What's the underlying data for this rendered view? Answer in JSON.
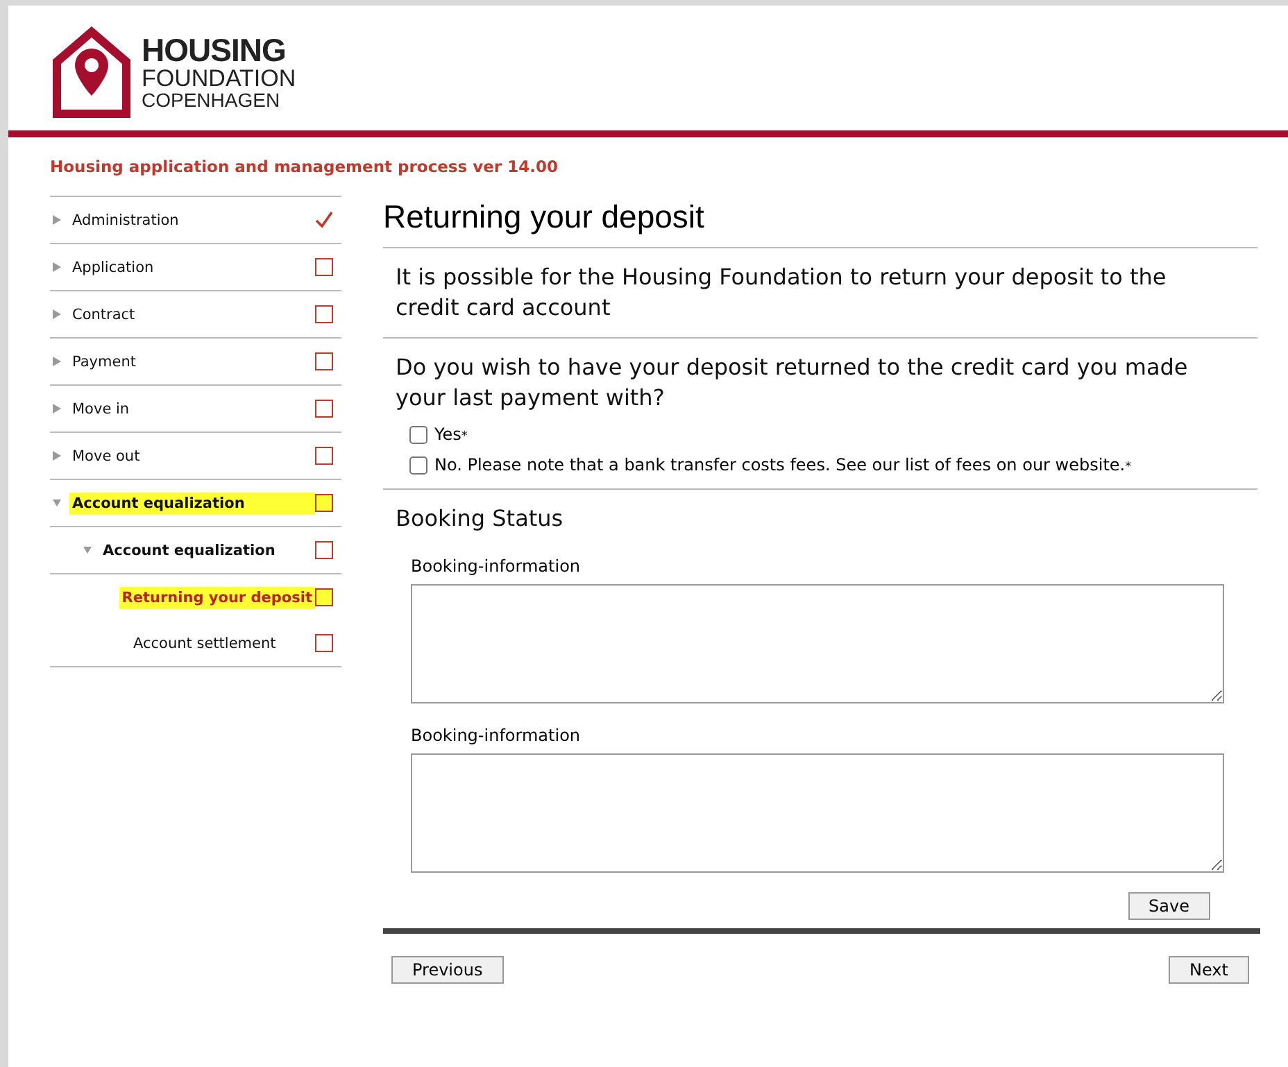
{
  "logo": {
    "line1": "HOUSING",
    "line2": "FOUNDATION",
    "line3": "COPENHAGEN"
  },
  "process_title": "Housing application and management process ver 14.00",
  "sidebar": {
    "items": [
      {
        "label": "Administration",
        "expanded": false,
        "done": true,
        "highlighted": false,
        "selected": false
      },
      {
        "label": "Application",
        "expanded": false,
        "done": false,
        "highlighted": false,
        "selected": false
      },
      {
        "label": "Contract",
        "expanded": false,
        "done": false,
        "highlighted": false,
        "selected": false
      },
      {
        "label": "Payment",
        "expanded": false,
        "done": false,
        "highlighted": false,
        "selected": false
      },
      {
        "label": "Move in",
        "expanded": false,
        "done": false,
        "highlighted": false,
        "selected": false
      },
      {
        "label": "Move out",
        "expanded": false,
        "done": false,
        "highlighted": false,
        "selected": false
      },
      {
        "label": "Account equalization",
        "expanded": true,
        "done": false,
        "highlighted": true,
        "selected": false,
        "children": [
          {
            "label": "Account equalization",
            "expanded": true,
            "done": false,
            "highlighted": false,
            "selected": false,
            "children": [
              {
                "label": "Returning your deposit",
                "done": false,
                "highlighted": true,
                "selected": true
              },
              {
                "label": "Account settlement",
                "done": false,
                "highlighted": false,
                "selected": false
              }
            ]
          }
        ]
      }
    ]
  },
  "page_title": "Returning your deposit",
  "info": "It is possible for the Housing Foundation to return your deposit to the credit card account",
  "question": "Do you wish to have your deposit returned to the credit card you made your last payment with?",
  "options": [
    {
      "label": "Yes",
      "required_mark": "*",
      "checked": false
    },
    {
      "label": "No. Please note that a bank transfer costs fees. See our list of fees on our website.",
      "required_mark": "*",
      "checked": false
    }
  ],
  "booking_title": "Booking Status",
  "booking_fields": [
    {
      "label": "Booking-information"
    },
    {
      "label": "Booking-information"
    }
  ],
  "save_button": "Save",
  "previous_button": "Previous",
  "next_button": "Next"
}
